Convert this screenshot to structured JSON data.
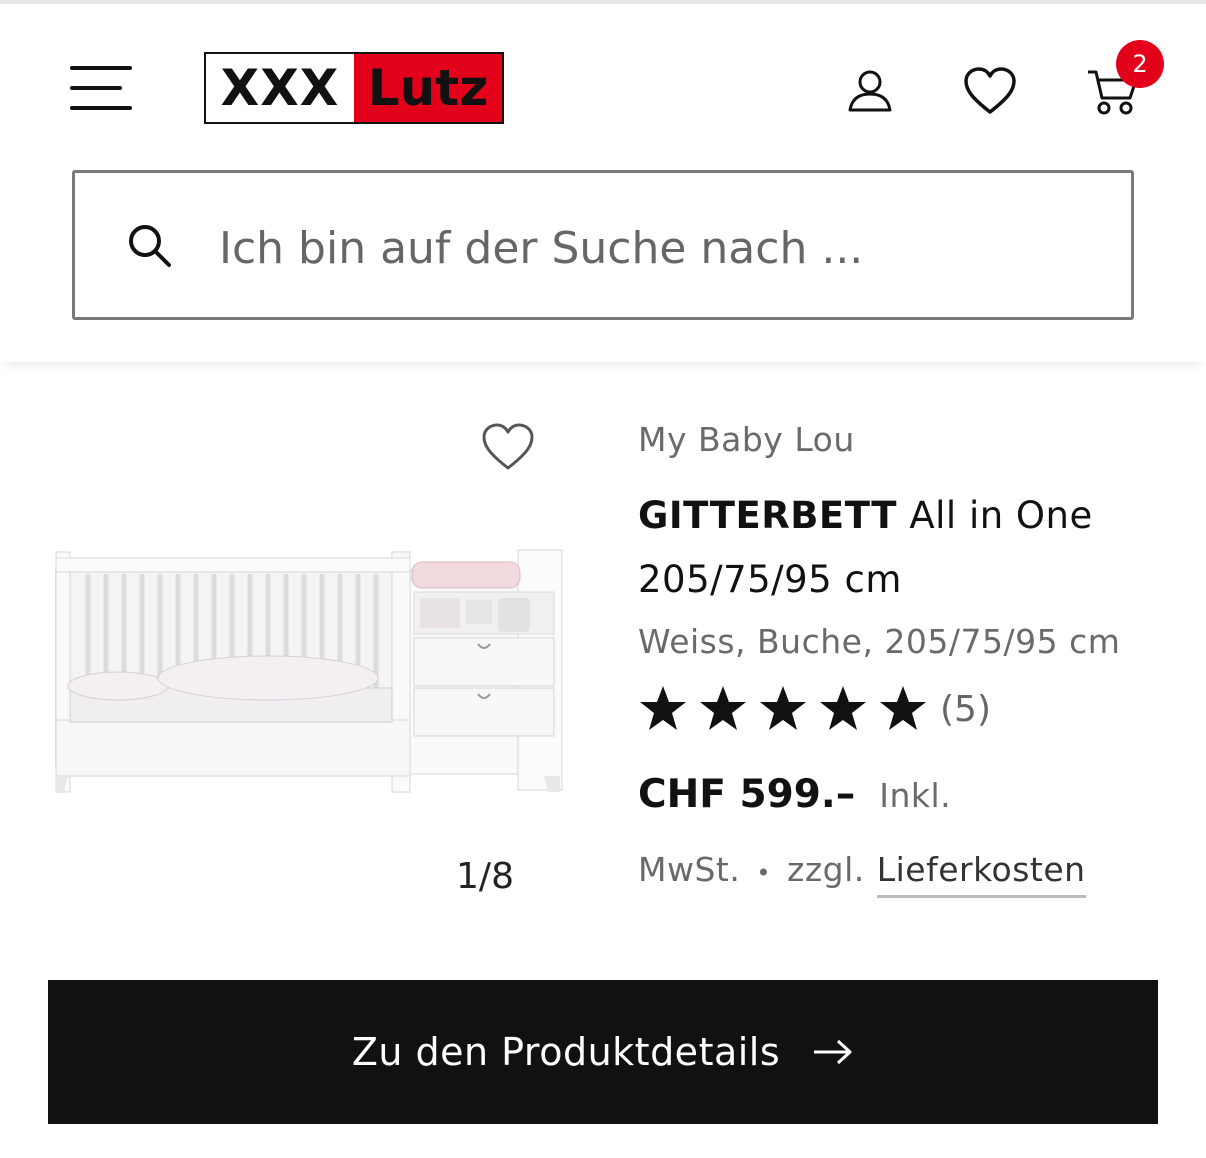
{
  "header": {
    "logo_left": "XXX",
    "logo_right": "Lutz",
    "cart_count": "2"
  },
  "search": {
    "placeholder": "Ich bin auf der Suche nach ..."
  },
  "product": {
    "brand": "My Baby Lou",
    "title_bold": "GITTERBETT",
    "title_rest": "All in One 205/75/95 cm",
    "variant": "Weiss, Buche, 205/75/95 cm",
    "rating": 5,
    "review_count": "(5)",
    "price": "CHF 599.–",
    "tax_note_1": "Inkl.",
    "tax_note_2": "MwSt.",
    "separator": "•",
    "shipping_prefix": "zzgl.",
    "shipping_link": "Lieferkosten",
    "image_counter": "1/8"
  },
  "cta": {
    "label": "Zu den Produktdetails"
  },
  "colors": {
    "brand_red": "#e2001a",
    "cta_bg": "#111111"
  },
  "icons": [
    "menu-icon",
    "user-icon",
    "heart-icon",
    "cart-icon",
    "search-icon",
    "star-icon",
    "arrow-right-icon"
  ]
}
